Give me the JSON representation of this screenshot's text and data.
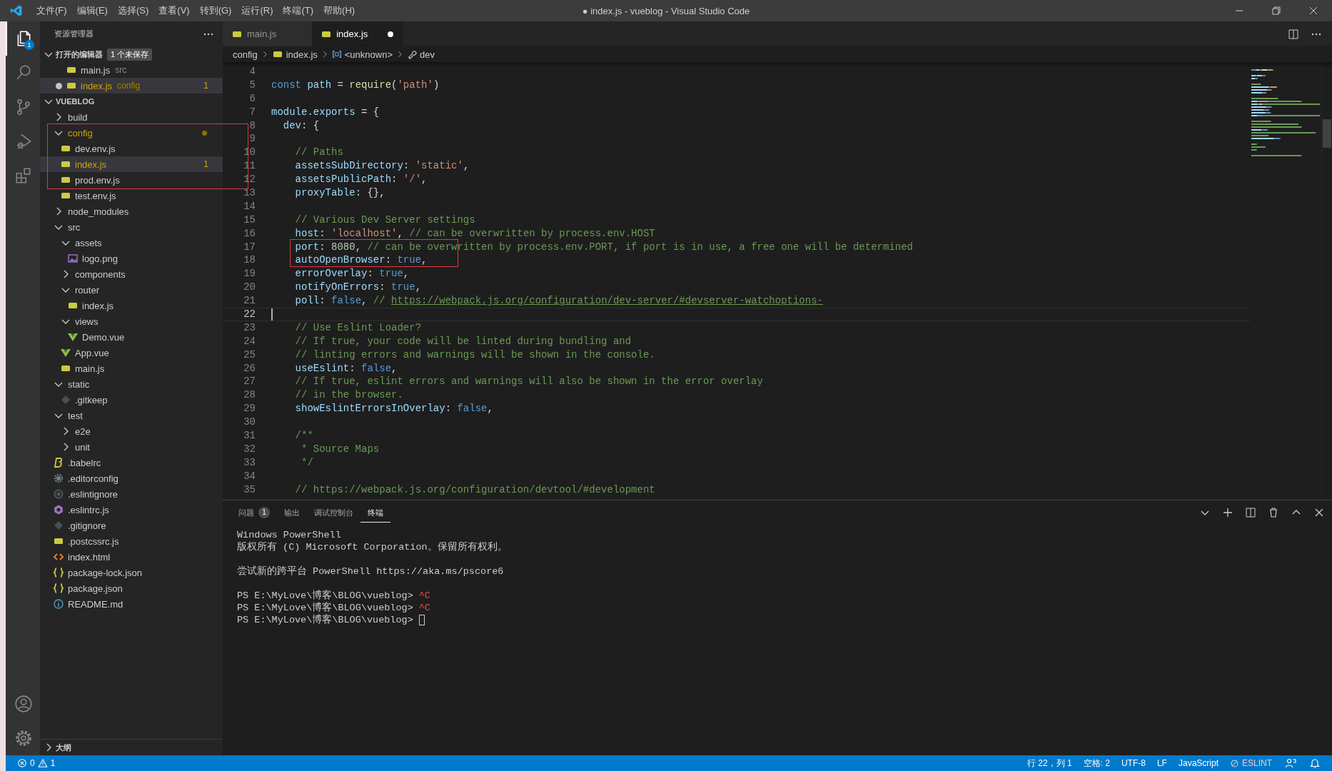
{
  "window": {
    "title": "● index.js - vueblog - Visual Studio Code",
    "menus": [
      "文件(F)",
      "编辑(E)",
      "选择(S)",
      "查看(V)",
      "转到(G)",
      "运行(R)",
      "终端(T)",
      "帮助(H)"
    ]
  },
  "activity_bar": {
    "items": [
      {
        "kind": "files",
        "selected": true,
        "badge": "1"
      },
      {
        "kind": "search",
        "selected": false
      },
      {
        "kind": "source-control",
        "selected": false
      },
      {
        "kind": "run",
        "selected": false
      },
      {
        "kind": "extensions",
        "selected": false
      }
    ],
    "bottom": [
      {
        "kind": "account"
      },
      {
        "kind": "settings"
      }
    ]
  },
  "sidebar": {
    "title": "资源管理器",
    "open_editors": {
      "title": "打开的编辑器",
      "expanded": true,
      "badge": "1 个未保存",
      "items": [
        {
          "name": "main.js",
          "description": "src",
          "selected": false,
          "modified": false,
          "warning": false
        },
        {
          "name": "index.js",
          "description": "config",
          "selected": true,
          "modified": true,
          "warning": true,
          "problems": "1"
        }
      ]
    },
    "folder": {
      "title": "VUEBLOG",
      "expanded": true,
      "tree": [
        {
          "name": "build",
          "kind": "folder",
          "expanded": false,
          "selected": false,
          "warning": false,
          "framed": false
        },
        {
          "name": "config",
          "kind": "folder",
          "expanded": true,
          "selected": false,
          "warning": true,
          "framed": true,
          "children": [
            {
              "name": "dev.env.js",
              "kind": "js",
              "selected": false,
              "warning": false,
              "framed": true
            },
            {
              "name": "index.js",
              "kind": "js",
              "selected": true,
              "warning": true,
              "framed": true,
              "problems": "1"
            },
            {
              "name": "prod.env.js",
              "kind": "js",
              "selected": false,
              "warning": false,
              "framed": true
            },
            {
              "name": "test.env.js",
              "kind": "js",
              "selected": false,
              "warning": false,
              "framed": false
            }
          ]
        },
        {
          "name": "node_modules",
          "kind": "folder",
          "expanded": false,
          "selected": false,
          "warning": false,
          "framed": false
        },
        {
          "name": "src",
          "kind": "folder",
          "expanded": true,
          "selected": false,
          "warning": false,
          "framed": false,
          "children": [
            {
              "name": "assets",
              "kind": "folder",
              "expanded": true,
              "selected": false,
              "warning": false,
              "framed": false,
              "children": [
                {
                  "name": "logo.png",
                  "kind": "image",
                  "selected": false,
                  "warning": false,
                  "framed": false
                }
              ]
            },
            {
              "name": "components",
              "kind": "folder",
              "expanded": false,
              "selected": false,
              "warning": false,
              "framed": false
            },
            {
              "name": "router",
              "kind": "folder",
              "expanded": true,
              "selected": false,
              "warning": false,
              "framed": false,
              "children": [
                {
                  "name": "index.js",
                  "kind": "js",
                  "selected": false,
                  "warning": false,
                  "framed": false
                }
              ]
            },
            {
              "name": "views",
              "kind": "folder",
              "expanded": true,
              "selected": false,
              "warning": false,
              "framed": false,
              "children": [
                {
                  "name": "Demo.vue",
                  "kind": "vue",
                  "selected": false,
                  "warning": false,
                  "framed": false
                }
              ]
            },
            {
              "name": "App.vue",
              "kind": "vue",
              "selected": false,
              "warning": false,
              "framed": false
            },
            {
              "name": "main.js",
              "kind": "js",
              "selected": false,
              "warning": false,
              "framed": false
            }
          ]
        },
        {
          "name": "static",
          "kind": "folder",
          "expanded": true,
          "selected": false,
          "warning": false,
          "framed": false,
          "children": [
            {
              "name": ".gitkeep",
              "kind": "git",
              "selected": false,
              "warning": false,
              "framed": false
            }
          ]
        },
        {
          "name": "test",
          "kind": "folder",
          "expanded": true,
          "selected": false,
          "warning": false,
          "framed": false,
          "children": [
            {
              "name": "e2e",
              "kind": "folder",
              "expanded": false,
              "selected": false,
              "warning": false,
              "framed": false
            },
            {
              "name": "unit",
              "kind": "folder",
              "expanded": false,
              "selected": false,
              "warning": false,
              "framed": false
            }
          ]
        },
        {
          "name": ".babelrc",
          "kind": "babel",
          "selected": false,
          "warning": false,
          "framed": false
        },
        {
          "name": ".editorconfig",
          "kind": "gear",
          "selected": false,
          "warning": false,
          "framed": false
        },
        {
          "name": ".eslintignore",
          "kind": "eslintignore",
          "selected": false,
          "warning": false,
          "framed": false
        },
        {
          "name": ".eslintrc.js",
          "kind": "eslint",
          "selected": false,
          "warning": false,
          "framed": false
        },
        {
          "name": ".gitignore",
          "kind": "git",
          "selected": false,
          "warning": false,
          "framed": false
        },
        {
          "name": ".postcssrc.js",
          "kind": "js",
          "selected": false,
          "warning": false,
          "framed": false
        },
        {
          "name": "index.html",
          "kind": "html",
          "selected": false,
          "warning": false,
          "framed": false
        },
        {
          "name": "package-lock.json",
          "kind": "json",
          "selected": false,
          "warning": false,
          "framed": false
        },
        {
          "name": "package.json",
          "kind": "json",
          "selected": false,
          "warning": false,
          "framed": false
        },
        {
          "name": "README.md",
          "kind": "info",
          "selected": false,
          "warning": false,
          "framed": false
        }
      ]
    },
    "outline": {
      "title": "大纲",
      "expanded": false
    }
  },
  "editor": {
    "tabs": [
      {
        "label": "main.js",
        "selected": false,
        "modified": false
      },
      {
        "label": "index.js",
        "selected": true,
        "modified": true
      }
    ],
    "breadcrumbs": [
      {
        "label": "config",
        "kind": "folder"
      },
      {
        "label": "index.js",
        "kind": "js"
      },
      {
        "label": "<unknown>",
        "kind": "object"
      },
      {
        "label": "dev",
        "kind": "property"
      }
    ],
    "lines": [
      {
        "number": "4",
        "current": false,
        "framed": false
      },
      {
        "number": "5",
        "current": false,
        "framed": false,
        "tokens": [
          {
            "kind": "kw",
            "text": "const "
          },
          {
            "kind": "var",
            "text": "path"
          },
          {
            "kind": "p",
            "text": " = "
          },
          {
            "kind": "fn",
            "text": "require"
          },
          {
            "kind": "p",
            "text": "("
          },
          {
            "kind": "str",
            "text": "'path'"
          },
          {
            "kind": "p",
            "text": ")"
          }
        ]
      },
      {
        "number": "6",
        "current": false,
        "framed": false
      },
      {
        "number": "7",
        "current": false,
        "framed": false,
        "tokens": [
          {
            "kind": "var",
            "text": "module"
          },
          {
            "kind": "p",
            "text": "."
          },
          {
            "kind": "var",
            "text": "exports"
          },
          {
            "kind": "p",
            "text": " = {"
          }
        ]
      },
      {
        "number": "8",
        "current": false,
        "framed": false,
        "tokens": [
          {
            "kind": "var",
            "text": "  dev"
          },
          {
            "kind": "p",
            "text": ": {"
          }
        ]
      },
      {
        "number": "9",
        "current": false,
        "framed": false
      },
      {
        "number": "10",
        "current": false,
        "framed": false,
        "tokens": [
          {
            "kind": "com",
            "text": "    // Paths"
          }
        ]
      },
      {
        "number": "11",
        "current": false,
        "framed": false,
        "tokens": [
          {
            "kind": "var",
            "text": "    assetsSubDirectory"
          },
          {
            "kind": "p",
            "text": ": "
          },
          {
            "kind": "str",
            "text": "'static'"
          },
          {
            "kind": "p",
            "text": ","
          }
        ]
      },
      {
        "number": "12",
        "current": false,
        "framed": false,
        "tokens": [
          {
            "kind": "var",
            "text": "    assetsPublicPath"
          },
          {
            "kind": "p",
            "text": ": "
          },
          {
            "kind": "str",
            "text": "'/'"
          },
          {
            "kind": "p",
            "text": ","
          }
        ]
      },
      {
        "number": "13",
        "current": false,
        "framed": false,
        "tokens": [
          {
            "kind": "var",
            "text": "    proxyTable"
          },
          {
            "kind": "p",
            "text": ": {},"
          }
        ]
      },
      {
        "number": "14",
        "current": false,
        "framed": false
      },
      {
        "number": "15",
        "current": false,
        "framed": false,
        "tokens": [
          {
            "kind": "com",
            "text": "    // Various Dev Server settings"
          }
        ]
      },
      {
        "number": "16",
        "current": false,
        "framed": false,
        "tokens": [
          {
            "kind": "var",
            "text": "    host"
          },
          {
            "kind": "p",
            "text": ": "
          },
          {
            "kind": "str",
            "text": "'localhost'"
          },
          {
            "kind": "p",
            "text": ", "
          },
          {
            "kind": "com",
            "text": "// can be overwritten by process.env.HOST"
          }
        ]
      },
      {
        "number": "17",
        "current": false,
        "framed": true,
        "tokens": [
          {
            "kind": "var",
            "text": "    port"
          },
          {
            "kind": "p",
            "text": ": "
          },
          {
            "kind": "num",
            "text": "8080"
          },
          {
            "kind": "p",
            "text": ", "
          },
          {
            "kind": "com",
            "text": "// can be overwritten by process.env.PORT, if port is in use, a free one will be determined"
          }
        ]
      },
      {
        "number": "18",
        "current": false,
        "framed": true,
        "tokens": [
          {
            "kind": "var",
            "text": "    autoOpenBrowser"
          },
          {
            "kind": "p",
            "text": ": "
          },
          {
            "kind": "kw",
            "text": "true"
          },
          {
            "kind": "p",
            "text": ","
          }
        ]
      },
      {
        "number": "19",
        "current": false,
        "framed": false,
        "tokens": [
          {
            "kind": "var",
            "text": "    errorOverlay"
          },
          {
            "kind": "p",
            "text": ": "
          },
          {
            "kind": "kw",
            "text": "true"
          },
          {
            "kind": "p",
            "text": ","
          }
        ]
      },
      {
        "number": "20",
        "current": false,
        "framed": false,
        "tokens": [
          {
            "kind": "var",
            "text": "    notifyOnErrors"
          },
          {
            "kind": "p",
            "text": ": "
          },
          {
            "kind": "kw",
            "text": "true"
          },
          {
            "kind": "p",
            "text": ","
          }
        ]
      },
      {
        "number": "21",
        "current": false,
        "framed": false,
        "tokens": [
          {
            "kind": "var",
            "text": "    poll"
          },
          {
            "kind": "p",
            "text": ": "
          },
          {
            "kind": "kw",
            "text": "false"
          },
          {
            "kind": "p",
            "text": ", "
          },
          {
            "kind": "com",
            "text": "// "
          },
          {
            "kind": "link",
            "text": "https://webpack.js.org/configuration/dev-server/#devserver-watchoptions-"
          }
        ]
      },
      {
        "number": "22",
        "current": true,
        "framed": false
      },
      {
        "number": "23",
        "current": false,
        "framed": false,
        "tokens": [
          {
            "kind": "com",
            "text": "    // Use Eslint Loader?"
          }
        ]
      },
      {
        "number": "24",
        "current": false,
        "framed": false,
        "tokens": [
          {
            "kind": "com",
            "text": "    // If true, your code will be linted during bundling and"
          }
        ]
      },
      {
        "number": "25",
        "current": false,
        "framed": false,
        "tokens": [
          {
            "kind": "com",
            "text": "    // linting errors and warnings will be shown in the console."
          }
        ]
      },
      {
        "number": "26",
        "current": false,
        "framed": false,
        "tokens": [
          {
            "kind": "var",
            "text": "    useEslint"
          },
          {
            "kind": "p",
            "text": ": "
          },
          {
            "kind": "kw",
            "text": "false"
          },
          {
            "kind": "p",
            "text": ","
          }
        ]
      },
      {
        "number": "27",
        "current": false,
        "framed": false,
        "tokens": [
          {
            "kind": "com",
            "text": "    // If true, eslint errors and warnings will also be shown in the error overlay"
          }
        ]
      },
      {
        "number": "28",
        "current": false,
        "framed": false,
        "tokens": [
          {
            "kind": "com",
            "text": "    // in the browser."
          }
        ]
      },
      {
        "number": "29",
        "current": false,
        "framed": false,
        "tokens": [
          {
            "kind": "var",
            "text": "    showEslintErrorsInOverlay"
          },
          {
            "kind": "p",
            "text": ": "
          },
          {
            "kind": "kw",
            "text": "false"
          },
          {
            "kind": "p",
            "text": ","
          }
        ]
      },
      {
        "number": "30",
        "current": false,
        "framed": false
      },
      {
        "number": "31",
        "current": false,
        "framed": false,
        "tokens": [
          {
            "kind": "com",
            "text": "    /**"
          }
        ]
      },
      {
        "number": "32",
        "current": false,
        "framed": false,
        "tokens": [
          {
            "kind": "com",
            "text": "     * Source Maps"
          }
        ]
      },
      {
        "number": "33",
        "current": false,
        "framed": false,
        "tokens": [
          {
            "kind": "com",
            "text": "     */"
          }
        ]
      },
      {
        "number": "34",
        "current": false,
        "framed": false
      },
      {
        "number": "35",
        "current": false,
        "framed": false,
        "tokens": [
          {
            "kind": "com",
            "text": "    // https://webpack.js.org/configuration/devtool/#development"
          }
        ]
      }
    ]
  },
  "panel": {
    "tabs": [
      {
        "label": "问题",
        "selected": false,
        "badge": "1"
      },
      {
        "label": "输出",
        "selected": false
      },
      {
        "label": "调试控制台",
        "selected": false
      },
      {
        "label": "终端",
        "selected": true
      }
    ],
    "terminal": [
      {
        "kind": "text",
        "text": "Windows PowerShell"
      },
      {
        "kind": "text",
        "text": "版权所有 (C) Microsoft Corporation。保留所有权利。"
      },
      {
        "kind": "blank"
      },
      {
        "kind": "text",
        "text": "尝试新的跨平台 PowerShell https://aka.ms/pscore6"
      },
      {
        "kind": "blank"
      },
      {
        "kind": "prompt",
        "prompt": "PS E:\\MyLove\\博客\\BLOG\\vueblog>",
        "input": "^C",
        "cursor": false
      },
      {
        "kind": "prompt",
        "prompt": "PS E:\\MyLove\\博客\\BLOG\\vueblog>",
        "input": "^C",
        "cursor": false
      },
      {
        "kind": "prompt",
        "prompt": "PS E:\\MyLove\\博客\\BLOG\\vueblog>",
        "cursor": true
      }
    ]
  },
  "status_bar": {
    "errors": "0",
    "warnings": "1",
    "items": [
      {
        "kind": "text",
        "text": "行 22，列 1"
      },
      {
        "kind": "text",
        "text": "空格: 2"
      },
      {
        "kind": "text",
        "text": "UTF-8"
      },
      {
        "kind": "text",
        "text": "LF"
      },
      {
        "kind": "text",
        "text": "JavaScript"
      },
      {
        "kind": "eslint",
        "text": "ESLINT"
      }
    ]
  }
}
